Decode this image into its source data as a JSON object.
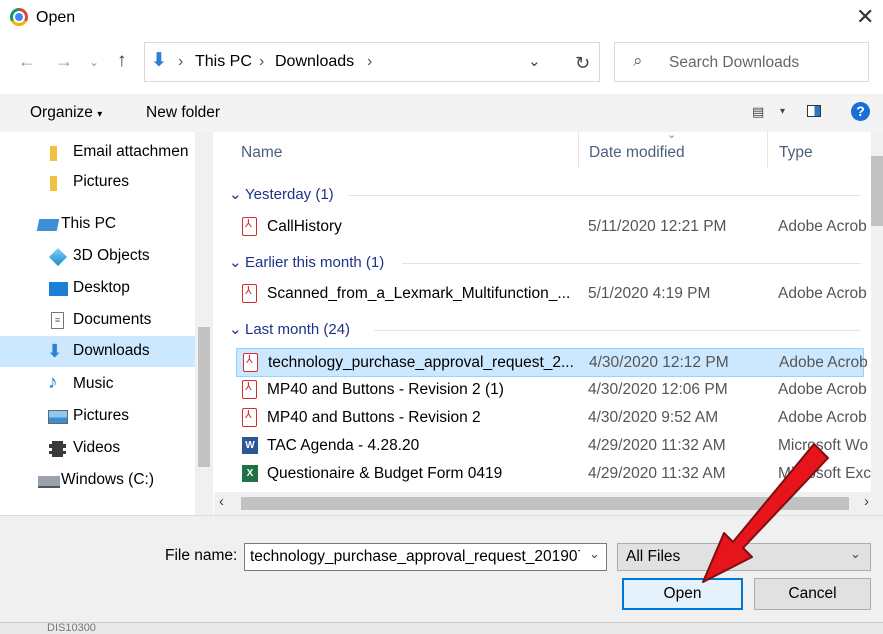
{
  "window": {
    "title": "Open"
  },
  "address": {
    "crumbs": [
      "This PC",
      "Downloads"
    ],
    "search_placeholder": "Search Downloads"
  },
  "toolbar": {
    "organize": "Organize",
    "new_folder": "New folder"
  },
  "nav": {
    "items": [
      {
        "label": "Email attachmen",
        "icon": "folder-icon"
      },
      {
        "label": "Pictures",
        "icon": "folder-icon"
      },
      {
        "label": "This PC",
        "icon": "computer-icon"
      },
      {
        "label": "3D Objects",
        "icon": "cube-icon"
      },
      {
        "label": "Desktop",
        "icon": "desktop-icon"
      },
      {
        "label": "Documents",
        "icon": "documents-icon"
      },
      {
        "label": "Downloads",
        "icon": "download-arrow-icon",
        "selected": true
      },
      {
        "label": "Music",
        "icon": "music-note-icon"
      },
      {
        "label": "Pictures",
        "icon": "pictures-icon"
      },
      {
        "label": "Videos",
        "icon": "film-icon"
      },
      {
        "label": "Windows (C:)",
        "icon": "drive-icon"
      }
    ]
  },
  "list": {
    "headers": {
      "name": "Name",
      "date": "Date modified",
      "type": "Type"
    },
    "groups": [
      {
        "label": "Yesterday (1)"
      },
      {
        "label": "Earlier this month (1)"
      },
      {
        "label": "Last month (24)"
      }
    ],
    "rows": [
      {
        "name": "CallHistory",
        "date": "5/11/2020 12:21 PM",
        "type": "Adobe Acrob",
        "icon": "pdf-icon"
      },
      {
        "name": "Scanned_from_a_Lexmark_Multifunction_...",
        "date": "5/1/2020 4:19 PM",
        "type": "Adobe Acrob",
        "icon": "pdf-icon"
      },
      {
        "name": "technology_purchase_approval_request_2...",
        "date": "4/30/2020 12:12 PM",
        "type": "Adobe Acrob",
        "icon": "pdf-icon",
        "selected": true
      },
      {
        "name": "MP40 and Buttons - Revision 2 (1)",
        "date": "4/30/2020 12:06 PM",
        "type": "Adobe Acrob",
        "icon": "pdf-icon"
      },
      {
        "name": "MP40 and Buttons - Revision 2",
        "date": "4/30/2020 9:52 AM",
        "type": "Adobe Acrob",
        "icon": "pdf-icon"
      },
      {
        "name": "TAC Agenda - 4.28.20",
        "date": "4/29/2020 11:32 AM",
        "type": "Microsoft Wo",
        "icon": "word-icon"
      },
      {
        "name": "Questionaire & Budget Form 0419",
        "date": "4/29/2020 11:32 AM",
        "type": "Microsoft Exc",
        "icon": "excel-icon"
      }
    ]
  },
  "footer": {
    "file_name_label": "File name:",
    "file_name_value": "technology_purchase_approval_request_201907",
    "filter": "All Files",
    "open": "Open",
    "cancel": "Cancel"
  },
  "background_text": "DIS10300",
  "colors": {
    "selection": "#cce8ff",
    "accent": "#0078d7",
    "arrow": "#e8141b"
  }
}
